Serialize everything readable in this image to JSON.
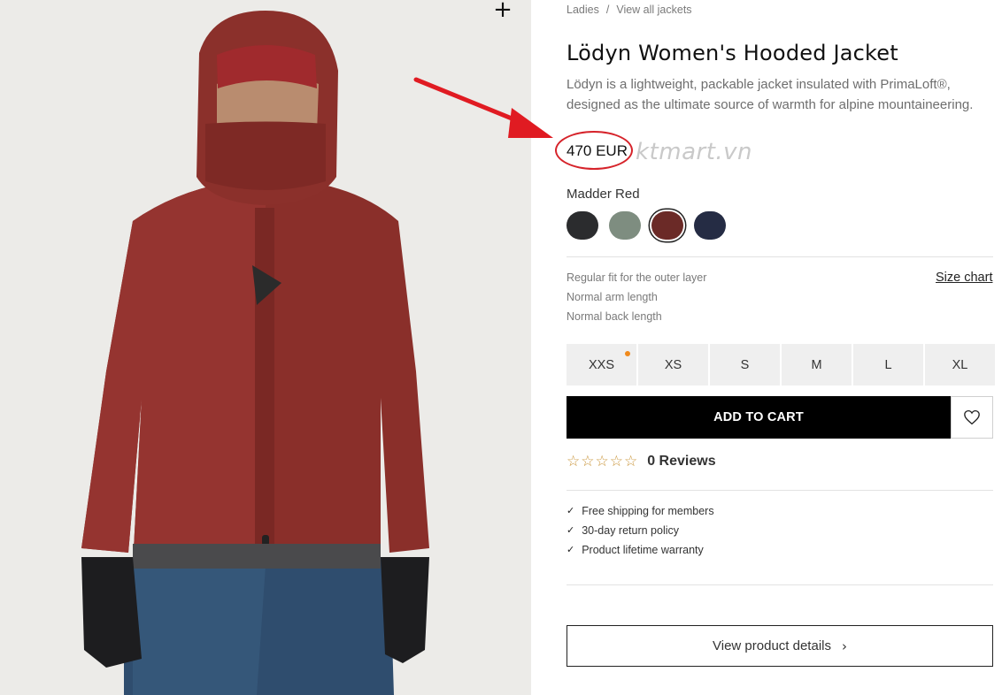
{
  "breadcrumb": {
    "items": [
      "Ladies",
      "View all jackets"
    ],
    "separator": "/"
  },
  "product": {
    "title": "Lödyn Women's Hooded Jacket",
    "description": "Lödyn is a lightweight, packable jacket insulated with PrimaLoft®, designed as the ultimate source of warmth for alpine mountaineering.",
    "price": "470 EUR"
  },
  "watermark": "ktmart.vn",
  "color": {
    "selected_label": "Madder Red",
    "swatches": [
      {
        "name": "black",
        "hex": "#2b2c2e"
      },
      {
        "name": "sage",
        "hex": "#7e8d80"
      },
      {
        "name": "madder-red",
        "hex": "#6b2a27"
      },
      {
        "name": "navy",
        "hex": "#252c44"
      }
    ]
  },
  "fit": {
    "lines": [
      "Regular fit for the outer layer",
      "Normal arm length",
      "Normal back length"
    ],
    "size_chart_label": "Size chart"
  },
  "sizes": [
    "XXS",
    "XS",
    "S",
    "M",
    "L",
    "XL"
  ],
  "cart": {
    "add_label": "ADD TO CART"
  },
  "reviews": {
    "stars": "☆☆☆☆☆",
    "label": "0 Reviews"
  },
  "benefits": [
    "Free shipping for members",
    "30-day return policy",
    "Product lifetime warranty"
  ],
  "details": {
    "label": "View product details"
  },
  "colors": {
    "annotation_red": "#d6232a",
    "low_stock_dot": "#f08a1c"
  }
}
